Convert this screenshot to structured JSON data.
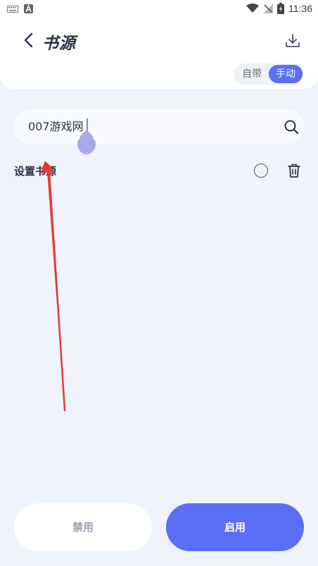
{
  "status_bar": {
    "time": "11:36"
  },
  "header": {
    "title": "书源",
    "toggle": {
      "options": [
        "自带",
        "手动"
      ],
      "selected": "手动"
    }
  },
  "search": {
    "value": "007游戏网"
  },
  "row": {
    "label": "设置书源"
  },
  "buttons": {
    "disable": "禁用",
    "enable": "启用"
  },
  "colors": {
    "accent": "#5b6ef5",
    "background": "#eef3fd",
    "arrow": "#e53935"
  },
  "icons": [
    "keyboard-icon",
    "a-box-icon",
    "wifi-icon",
    "signal-icon",
    "battery-icon",
    "back-icon",
    "download-icon",
    "search-icon",
    "trash-icon"
  ]
}
